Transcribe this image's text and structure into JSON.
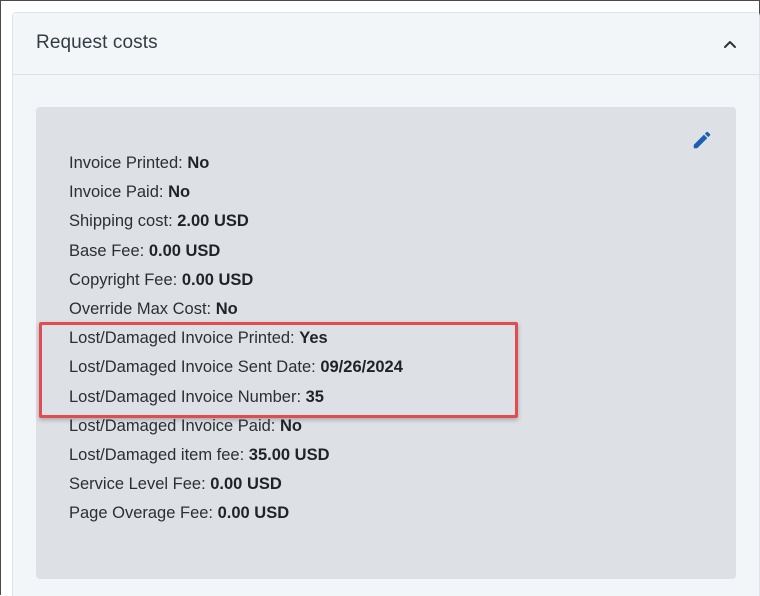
{
  "panel": {
    "title": "Request costs",
    "collapse_icon": "chevron-up-icon",
    "edit_icon": "pencil-icon",
    "accent_color": "#1a5fb4",
    "highlight_color": "#e24b4f"
  },
  "fields": [
    {
      "label": "Invoice Printed:",
      "value": "No"
    },
    {
      "label": "Invoice Paid:",
      "value": "No"
    },
    {
      "label": "Shipping cost:",
      "value": "2.00 USD"
    },
    {
      "label": "Base Fee:",
      "value": "0.00 USD"
    },
    {
      "label": "Copyright Fee:",
      "value": "0.00 USD"
    },
    {
      "label": "Override Max Cost:",
      "value": "No"
    },
    {
      "label": "Lost/Damaged Invoice Printed:",
      "value": "Yes"
    },
    {
      "label": "Lost/Damaged Invoice Sent Date:",
      "value": "09/26/2024"
    },
    {
      "label": "Lost/Damaged Invoice Number:",
      "value": "35"
    },
    {
      "label": "Lost/Damaged Invoice Paid:",
      "value": "No"
    },
    {
      "label": "Lost/Damaged item fee:",
      "value": "35.00 USD"
    },
    {
      "label": "Service Level Fee:",
      "value": "0.00 USD"
    },
    {
      "label": "Page Overage Fee:",
      "value": "0.00 USD"
    }
  ]
}
